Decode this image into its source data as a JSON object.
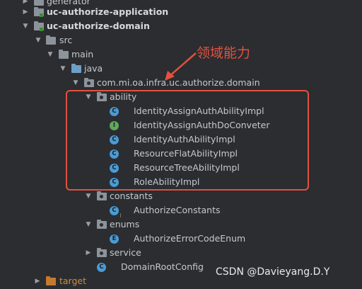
{
  "tree": {
    "items": [
      {
        "label": "generator",
        "type": "folder"
      },
      {
        "label": "uc-authorize-application",
        "type": "module"
      },
      {
        "label": "uc-authorize-domain",
        "type": "module"
      },
      {
        "label": "src",
        "type": "folder"
      },
      {
        "label": "main",
        "type": "folder"
      },
      {
        "label": "java",
        "type": "source-folder"
      },
      {
        "label": "com.mi.oa.infra.uc.authorize.domain",
        "type": "package"
      },
      {
        "label": "ability",
        "type": "package"
      },
      {
        "label": "IdentityAssignAuthAbilityImpl",
        "type": "class",
        "badge": "C"
      },
      {
        "label": "IdentityAssignAuthDoConveter",
        "type": "interface",
        "badge": "I"
      },
      {
        "label": "IdentityAuthAbilityImpl",
        "type": "class",
        "badge": "C"
      },
      {
        "label": "ResourceFlatAbilityImpl",
        "type": "class",
        "badge": "C"
      },
      {
        "label": "ResourceTreeAbilityImpl",
        "type": "class",
        "badge": "C"
      },
      {
        "label": "RoleAbilityImpl",
        "type": "class",
        "badge": "C"
      },
      {
        "label": "constants",
        "type": "package"
      },
      {
        "label": "AuthorizeConstants",
        "type": "class",
        "badge": "C"
      },
      {
        "label": "enums",
        "type": "package"
      },
      {
        "label": "AuthorizeErrorCodeEnum",
        "type": "enum",
        "badge": "E"
      },
      {
        "label": "service",
        "type": "package"
      },
      {
        "label": "DomainRootConfig",
        "type": "class",
        "badge": "C"
      },
      {
        "label": "target",
        "type": "excluded-folder"
      }
    ]
  },
  "annotation": {
    "text": "领域能力",
    "color": "#e2513f"
  },
  "watermark": {
    "text": "CSDN @Davieyang.D.Y"
  },
  "colors": {
    "background": "#2b2d30",
    "highlight": "#e2513f",
    "class_badge": "#4a9bd6",
    "interface_badge": "#5fa95b"
  }
}
